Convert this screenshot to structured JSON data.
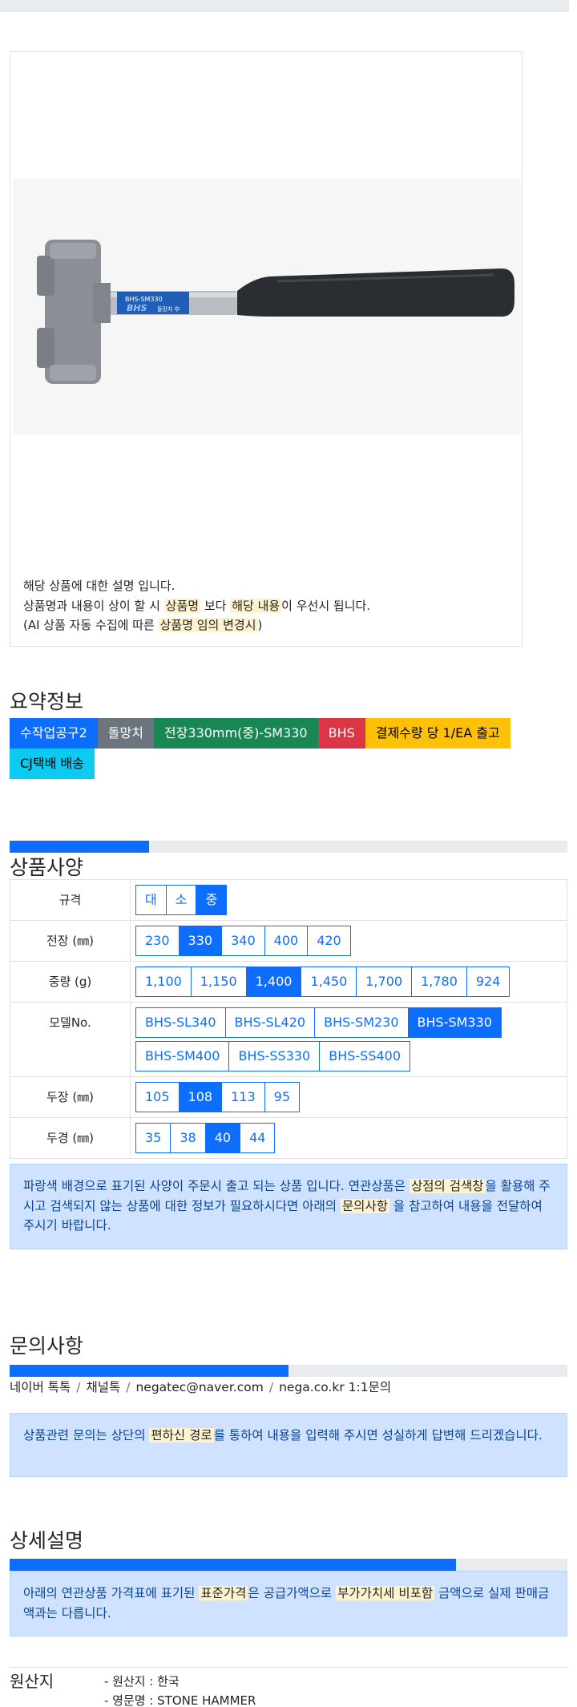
{
  "product_image": {
    "note_line1": "해당 상품에 대한 설명 입니다.",
    "note_line2_pre": "상품명과 내용이 상이 할 시 ",
    "note_line2_mark1": "상품명",
    "note_line2_mid": " 보다 ",
    "note_line2_mark2": "해당 내용",
    "note_line2_post": "이 우선시 됩니다.",
    "note_line3_pre": "(AI 상품 자동 수집에 따른 ",
    "note_line3_mark": "상품명 임의 변경시",
    "note_line3_post": ")",
    "handle_text1": "BHS-SM330",
    "handle_text2": "BHS",
    "handle_text3": "돌망치 中"
  },
  "summary": {
    "title": "요약정보",
    "badges": [
      {
        "label": "수작업공구2",
        "color": "#0d6efd",
        "text_color": "#ffffff"
      },
      {
        "label": "돌망치",
        "color": "#6c757d",
        "text_color": "#ffffff"
      },
      {
        "label": "전장330mm(중)-SM330",
        "color": "#198754",
        "text_color": "#ffffff"
      },
      {
        "label": "BHS",
        "color": "#dc3545",
        "text_color": "#ffffff"
      },
      {
        "label": "결제수량 당 1/EA 출고",
        "color": "#ffc107",
        "text_color": "#000000"
      },
      {
        "label": "CJ택배 배송",
        "color": "#0dcaf0",
        "text_color": "#000000"
      }
    ]
  },
  "spec": {
    "title": "상품사양",
    "progress": 0.25,
    "rows": [
      {
        "label": "규격",
        "options": [
          "대",
          "소",
          "중"
        ],
        "selected": "중"
      },
      {
        "label": "전장 (㎜)",
        "options": [
          "230",
          "330",
          "340",
          "400",
          "420"
        ],
        "selected": "330"
      },
      {
        "label": "중량 (g)",
        "options": [
          "1,100",
          "1,150",
          "1,400",
          "1,450",
          "1,700",
          "1,780",
          "924"
        ],
        "selected": "1,400"
      },
      {
        "label": "모델No.",
        "options": [
          "BHS-SL340",
          "BHS-SL420",
          "BHS-SM230",
          "BHS-SM330",
          "BHS-SM400",
          "BHS-SS330",
          "BHS-SS400"
        ],
        "selected": "BHS-SM330",
        "break_after": 3
      },
      {
        "label": "두장 (㎜)",
        "options": [
          "105",
          "108",
          "113",
          "95"
        ],
        "selected": "108"
      },
      {
        "label": "두경 (㎜)",
        "options": [
          "35",
          "38",
          "40",
          "44"
        ],
        "selected": "40"
      }
    ],
    "alert_pre": "파랑색 배경으로 표기된 사양이 주문시 출고 되는 상품 입니다. 연관상품은 ",
    "alert_mark1": "상점의 검색창",
    "alert_mid": "을 활용해 주시고 검색되지 않는 상품에 대한 정보가 필요하시다면 아래의 ",
    "alert_mark2": "문의사항",
    "alert_post": " 을 참고하여 내용을 전달하여 주시기 바랍니다."
  },
  "inquiry": {
    "title": "문의사항",
    "progress": 0.5,
    "contacts": [
      "네이버 톡톡",
      "채널톡",
      "negatec@naver.com",
      "nega.co.kr 1:1문의"
    ],
    "separator": "/",
    "alert_pre": "상품관련 문의는 상단의 ",
    "alert_mark": "편하신 경로",
    "alert_post": "를 통하여 내용을 입력해 주시면 성실하게 답변해 드리겠습니다."
  },
  "detail": {
    "title": "상세설명",
    "progress": 0.8,
    "alert_pre": "아래의 연관상품 가격표에 표기된 ",
    "alert_mark1": "표준가격",
    "alert_mid": "은 공급가액으로 ",
    "alert_mark2": "부가가치세 비포함",
    "alert_post": " 금액으로 실제 판매금액과는 다릅니다."
  },
  "origin": {
    "title": "원산지",
    "items": [
      "- 원산지 : 한국",
      "- 영문명 : STONE HAMMER"
    ]
  }
}
